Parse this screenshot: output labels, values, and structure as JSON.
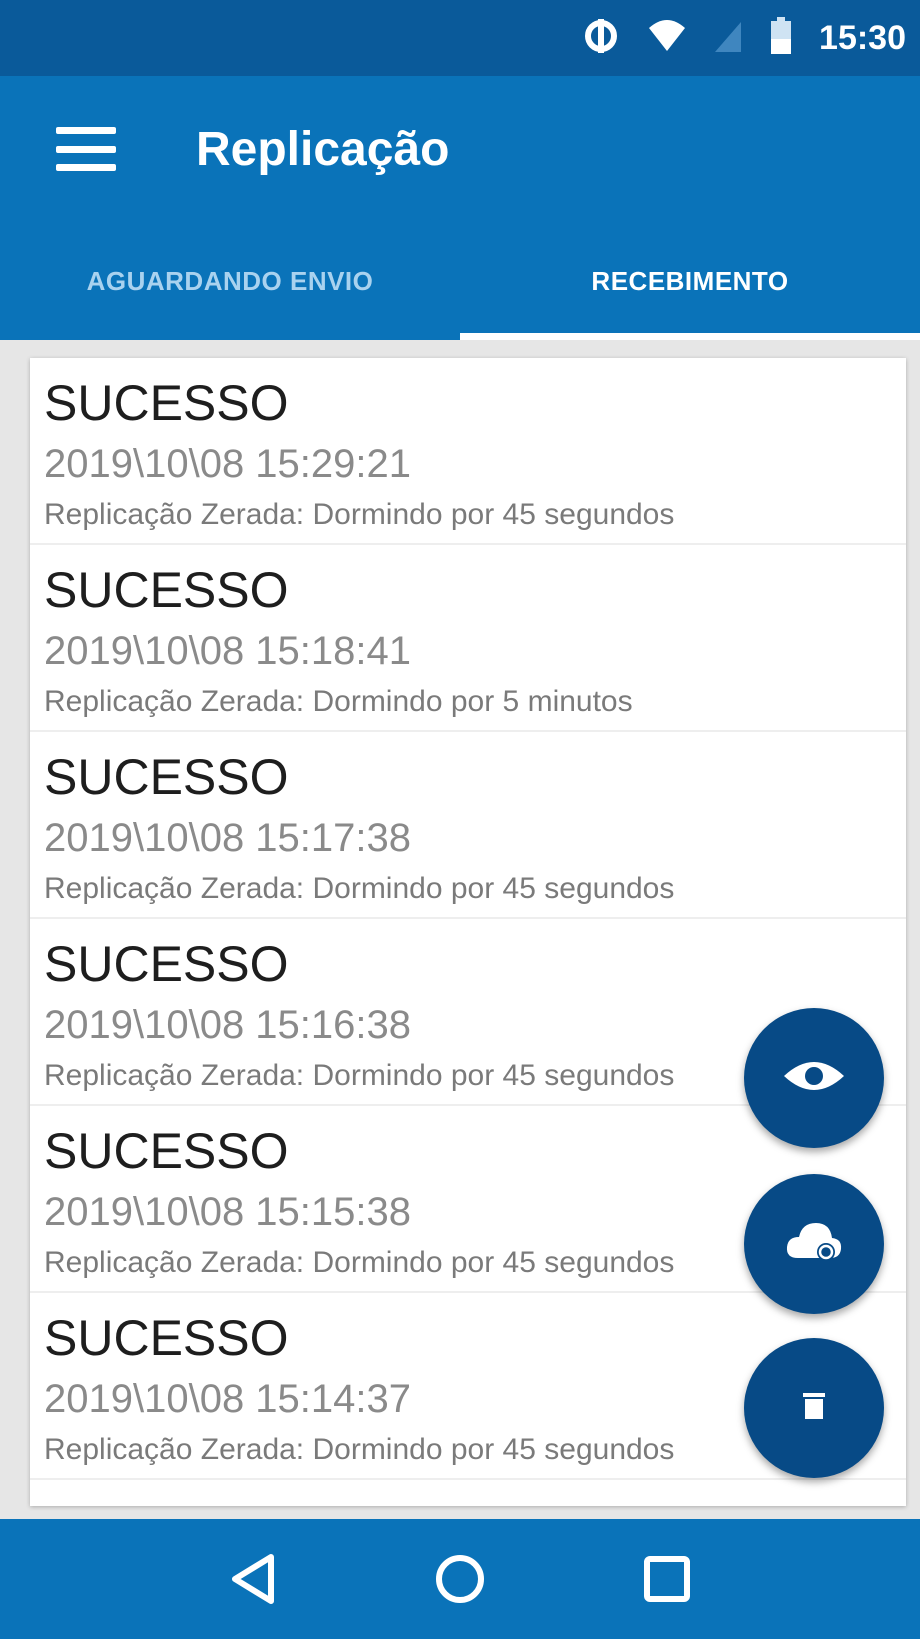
{
  "status_bar": {
    "time": "15:30",
    "icons": [
      "data-saver-icon",
      "wifi-icon",
      "signal-icon",
      "battery-icon"
    ]
  },
  "app_bar": {
    "title": "Replicação",
    "menu_icon": "menu-icon"
  },
  "tabs": [
    {
      "label": "AGUARDANDO ENVIO",
      "active": false
    },
    {
      "label": "RECEBIMENTO",
      "active": true
    }
  ],
  "entries": [
    {
      "status": "SUCESSO",
      "datetime": "2019\\10\\08 15:29:21",
      "message": "Replicação Zerada: Dormindo por 45 segundos"
    },
    {
      "status": "SUCESSO",
      "datetime": "2019\\10\\08 15:18:41",
      "message": "Replicação Zerada: Dormindo por 5 minutos"
    },
    {
      "status": "SUCESSO",
      "datetime": "2019\\10\\08 15:17:38",
      "message": "Replicação Zerada: Dormindo por 45 segundos"
    },
    {
      "status": "SUCESSO",
      "datetime": "2019\\10\\08 15:16:38",
      "message": "Replicação Zerada: Dormindo por 45 segundos"
    },
    {
      "status": "SUCESSO",
      "datetime": "2019\\10\\08 15:15:38",
      "message": "Replicação Zerada: Dormindo por 45 segundos"
    },
    {
      "status": "SUCESSO",
      "datetime": "2019\\10\\08 15:14:37",
      "message": "Replicação Zerada: Dormindo por 45 segundos"
    }
  ],
  "fabs": [
    "eye-icon",
    "cloud-sync-icon",
    "delete-icon"
  ],
  "nav_bar": [
    "back-icon",
    "home-icon",
    "recents-icon"
  ],
  "colors": {
    "status_bar": "#0a5a9a",
    "primary": "#0a73b9",
    "fab": "#074a86",
    "inactive_tab": "#a9d2ef"
  }
}
